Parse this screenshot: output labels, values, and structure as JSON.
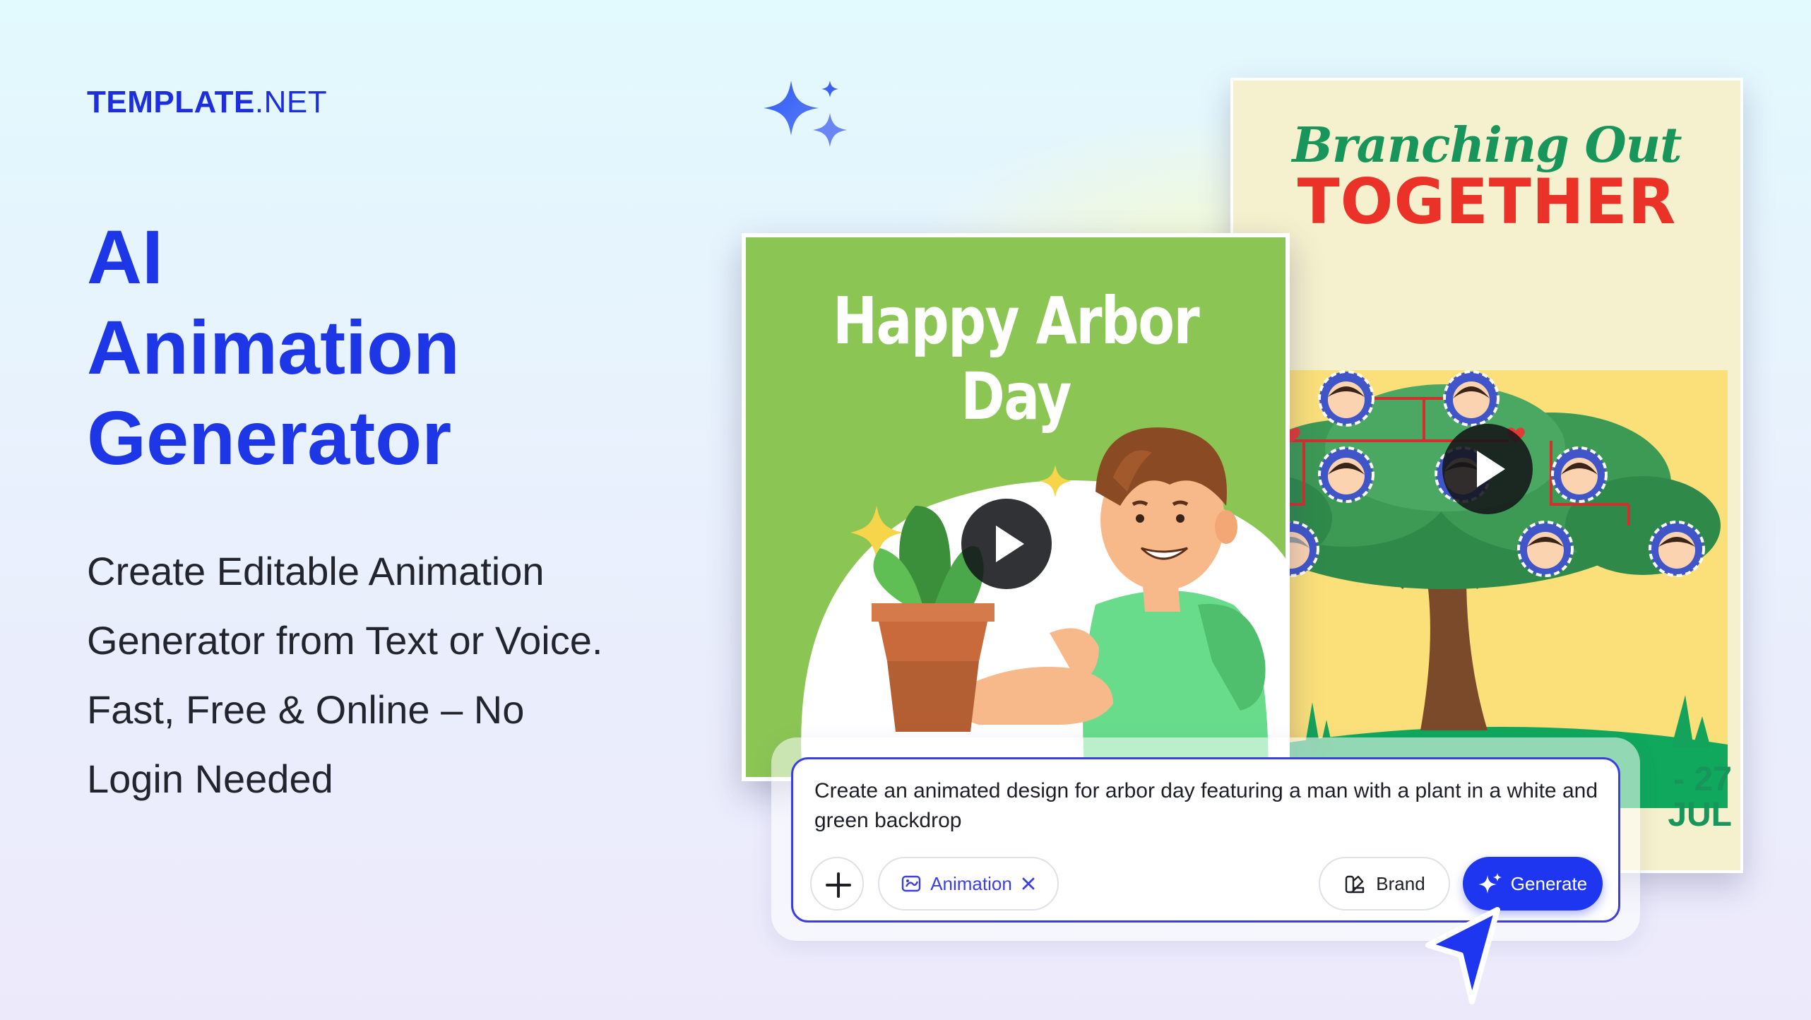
{
  "brand": {
    "logo_bold": "TEMPLATE",
    "logo_thin": ".NET"
  },
  "hero": {
    "title_lines": [
      "AI",
      "Animation",
      "Generator"
    ],
    "subtitle_lines": [
      "Create Editable Animation",
      "Generator from Text or Voice.",
      "Fast, Free & Online – No",
      "Login Needed"
    ]
  },
  "card_back": {
    "title_script": "Branching Out",
    "title_bold": "TOGETHER",
    "date_lines": [
      "- 27",
      "JUL"
    ]
  },
  "card_front": {
    "title": "Happy Arbor Day"
  },
  "prompt": {
    "text": "Create an animated design for arbor day featuring a man with a plant in a white and green backdrop",
    "chip_animation": "Animation",
    "chip_brand": "Brand",
    "generate_label": "Generate"
  },
  "colors": {
    "accent": "#1d36e6",
    "generate": "#1f36f0",
    "card_front_bg": "#8bc654",
    "card_back_bg": "#f5f0cd",
    "tree_green": "#17955a",
    "together_red": "#ea3228"
  },
  "icons": [
    "sparkles-icon",
    "play-icon",
    "plus-icon",
    "animation-icon",
    "close-icon",
    "brand-icon",
    "sparkle-icon",
    "cursor-icon"
  ]
}
